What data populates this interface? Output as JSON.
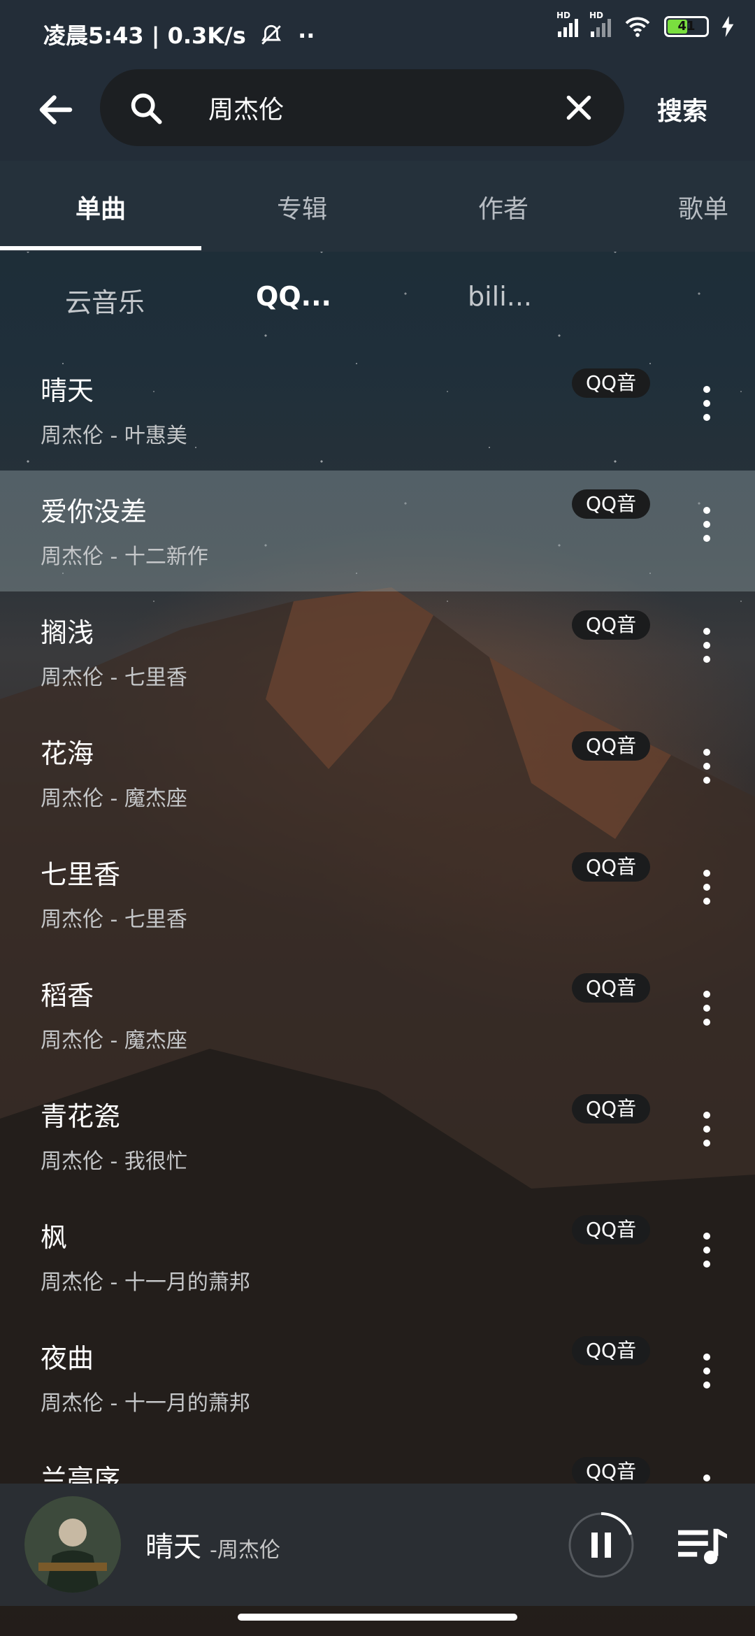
{
  "status": {
    "time_info": "凌晨5:43 | 0.3K/s",
    "mute_icon": "bell-off-icon",
    "dots": "··",
    "battery": "41",
    "signal_label": "HD"
  },
  "header": {
    "search_value": "周杰伦",
    "search_button": "搜索"
  },
  "tabs": [
    {
      "label": "单曲"
    },
    {
      "label": "专辑"
    },
    {
      "label": "作者"
    },
    {
      "label": "歌单"
    }
  ],
  "sources": [
    {
      "label": "云音乐"
    },
    {
      "label": "QQ..."
    },
    {
      "label": "bili..."
    }
  ],
  "songs": [
    {
      "title": "晴天",
      "subtitle": "周杰伦 - 叶惠美",
      "badge": "QQ音"
    },
    {
      "title": "爱你没差",
      "subtitle": "周杰伦 - 十二新作",
      "badge": "QQ音"
    },
    {
      "title": "搁浅",
      "subtitle": "周杰伦 - 七里香",
      "badge": "QQ音"
    },
    {
      "title": "花海",
      "subtitle": "周杰伦 - 魔杰座",
      "badge": "QQ音"
    },
    {
      "title": "七里香",
      "subtitle": "周杰伦 - 七里香",
      "badge": "QQ音"
    },
    {
      "title": "稻香",
      "subtitle": "周杰伦 - 魔杰座",
      "badge": "QQ音"
    },
    {
      "title": "青花瓷",
      "subtitle": "周杰伦 - 我很忙",
      "badge": "QQ音"
    },
    {
      "title": "枫",
      "subtitle": "周杰伦 - 十一月的萧邦",
      "badge": "QQ音"
    },
    {
      "title": "夜曲",
      "subtitle": "周杰伦 - 十一月的萧邦",
      "badge": "QQ音"
    },
    {
      "title": "兰亭序",
      "subtitle": "",
      "badge": "QQ音"
    }
  ],
  "player": {
    "title": "晴天",
    "artist": "-周杰伦"
  },
  "colors": {
    "bar_bg": "#232d38",
    "highlight_row": "#8c9ba0",
    "badge_bg": "#1b1c1d"
  }
}
